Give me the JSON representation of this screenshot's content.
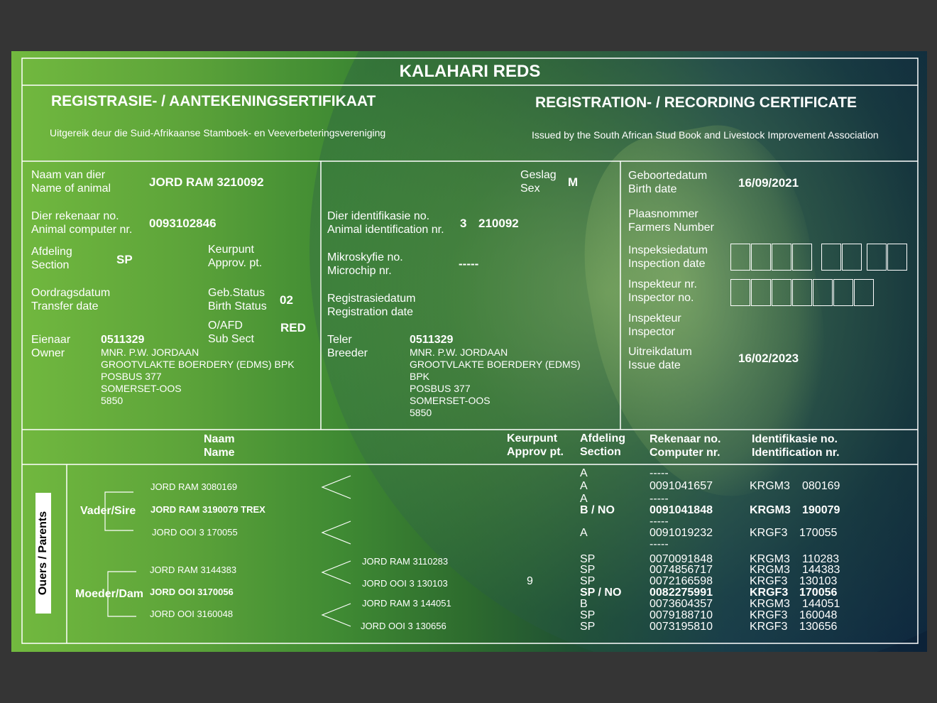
{
  "title": "KALAHARI REDS",
  "heading_af": "REGISTRASIE- / AANTEKENINGSERTIFIKAAT",
  "heading_en": "REGISTRATION- / RECORDING CERTIFICATE",
  "issued_af": "Uitgereik deur die Suid-Afrikaanse Stamboek- en Veeverbeteringsvereniging",
  "issued_en": "Issued by the South African Stud Book and Livestock Improvement Association",
  "labels": {
    "name_af": "Naam van dier",
    "name_en": "Name of animal",
    "sex_af": "Geslag",
    "sex_en": "Sex",
    "birth_af": "Geboortedatum",
    "birth_en": "Birth date",
    "comp_af": "Dier rekenaar no.",
    "comp_en": "Animal computer nr.",
    "ident_af": "Dier identifikasie no.",
    "ident_en": "Animal identification nr.",
    "farm_af": "Plaasnommer",
    "farm_en": "Farmers Number",
    "section_af": "Afdeling",
    "section_en": "Section",
    "approv_af": "Keurpunt",
    "approv_en": "Approv. pt.",
    "micro_af": "Mikroskyfie no.",
    "micro_en": "Microchip nr.",
    "insp_date_af": "Inspeksiedatum",
    "insp_date_en": "Inspection date",
    "transfer_af": "Oordragsdatum",
    "transfer_en": "Transfer date",
    "bstatus_af": "Geb.Status",
    "bstatus_en": "Birth Status",
    "regdate_af": "Registrasiedatum",
    "regdate_en": "Registration date",
    "inspno_af": "Inspekteur nr.",
    "inspno_en": "Inspector no.",
    "subsect_af": "O/AFD",
    "subsect_en": "Sub Sect",
    "inspector_af": "Inspekteur",
    "inspector_en": "Inspector",
    "owner_af": "Eienaar",
    "owner_en": "Owner",
    "breeder_af": "Teler",
    "breeder_en": "Breeder",
    "issue_af": "Uitreikdatum",
    "issue_en": "Issue date"
  },
  "animal": {
    "name": "JORD RAM 3210092",
    "sex": "M",
    "birth_date": "16/09/2021",
    "computer_nr": "0093102846",
    "ident_prefix": "3",
    "ident_nr": "210092",
    "section": "SP",
    "microchip": "-----",
    "birth_status": "02",
    "sub_sect": "RED",
    "issue_date": "16/02/2023"
  },
  "owner": {
    "code": "0511329",
    "lines": [
      "MNR. P.W. JORDAAN",
      "GROOTVLAKTE BOERDERY (EDMS) BPK",
      "POSBUS 377",
      "SOMERSET-OOS",
      "5850"
    ]
  },
  "breeder": {
    "code": "0511329",
    "lines": [
      "MNR. P.W. JORDAAN",
      "GROOTVLAKTE BOERDERY (EDMS)",
      "BPK",
      "POSBUS 377",
      "SOMERSET-OOS",
      "5850"
    ]
  },
  "pedigree_headers": {
    "name_af": "Naam",
    "name_en": "Name",
    "approv_af": "Keurpunt",
    "approv_en": "Approv pt.",
    "section_af": "Afdeling",
    "section_en": "Section",
    "comp_af": "Rekenaar no.",
    "comp_en": "Computer nr.",
    "ident_af": "Identifikasie no.",
    "ident_en": "Identification nr."
  },
  "parents_label": "Ouers / Parents",
  "sire_label": "Vader/Sire",
  "dam_label": "Moeder/Dam",
  "sire": {
    "name": "JORD RAM 3190079 TREX",
    "grand_sire": "JORD RAM 3080169",
    "grand_dam": "JORD OOI 3 170055"
  },
  "dam": {
    "name": "JORD OOI 3170056",
    "grand_sire": "JORD RAM 3144383",
    "grand_dam": "JORD OOI 3160048",
    "ggs1": "JORD RAM 3110283",
    "ggd1": "JORD OOI 3 130103",
    "ggs2": "JORD RAM 3 144051",
    "ggd2": "JORD OOI 3 130656"
  },
  "approv_value": "9",
  "sire_rows": {
    "s1": "A",
    "c1": "-----",
    "s2": "A",
    "c2": "0091041657",
    "id2a": "KRGM3",
    "id2b": "080169",
    "s3": "A",
    "c3": "-----",
    "s4": "B / NO",
    "c4": "0091041848",
    "id4a": "KRGM3",
    "id4b": "190079",
    "c5": "-----",
    "s6": "A",
    "c6": "0091019232",
    "id6a": "KRGF3",
    "id6b": "170055",
    "c7": "-----"
  },
  "dam_rows": [
    {
      "s": "SP",
      "c": "0070091848",
      "ia": "KRGM3",
      "ib": "110283",
      "bold": false
    },
    {
      "s": "SP",
      "c": "0074856717",
      "ia": "KRGM3",
      "ib": "144383",
      "bold": false
    },
    {
      "s": "SP",
      "c": "0072166598",
      "ia": "KRGF3",
      "ib": "130103",
      "bold": false
    },
    {
      "s": "SP / NO",
      "c": "0082275991",
      "ia": "KRGF3",
      "ib": "170056",
      "bold": true
    },
    {
      "s": "B",
      "c": "0073604357",
      "ia": "KRGM3",
      "ib": "144051",
      "bold": false
    },
    {
      "s": "SP",
      "c": "0079188710",
      "ia": "KRGF3",
      "ib": "160048",
      "bold": false
    },
    {
      "s": "SP",
      "c": "0073195810",
      "ia": "KRGF3",
      "ib": "130656",
      "bold": false
    }
  ]
}
